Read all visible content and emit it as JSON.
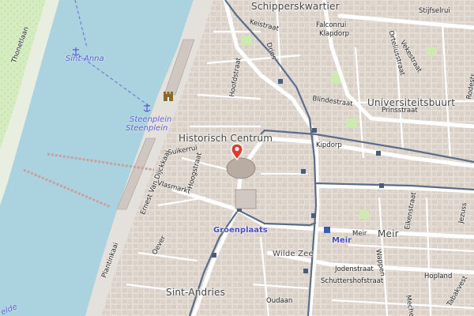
{
  "map": {
    "districts": {
      "schipperskwartier": "Schipperskwartier",
      "universiteitsbuurt": "Universiteitsbuurt",
      "historisch_centrum": "Historisch Centrum",
      "sint_andries": "Sint-Andries",
      "meir": "Meir"
    },
    "landmarks": {
      "sint_anna": "Sint-Anna",
      "steenplein_1": "Steenplein",
      "steenplein_2": "Steenplein",
      "groenplaats": "Groenplaats",
      "meir_station": "Meir",
      "wilde_zee": "Wilde Zee",
      "schelde": "elde"
    },
    "streets": {
      "keistraat": "Keistraat",
      "klapdorp": "Klapdorp",
      "falconrui": "Falconrui",
      "stijfselrui": "Stijfselrui",
      "vekestraat": "Vekestraat",
      "blindestraat": "Blindestraat",
      "prinsstraat": "Prinsstraat",
      "kipdorp": "Kipdorp",
      "suikerrui": "Suikerrui",
      "vlasmarkt": "Vlasmarkt",
      "hoogstraat": "Hoogstraat",
      "ernest_van_dijckkaai": "Ernest Van Dijckkaai",
      "plantinkaai": "Plantinkaai",
      "oever": "Oever",
      "wappen": "Wappen",
      "eikenstraat": "Eikenstraat",
      "meir_street": "Meir",
      "jodenstraat": "Jodenstraat",
      "schuttershofstraat": "Schuttershofstraat",
      "hopland": "Hopland",
      "oudaan": "Oudaan",
      "mechelse": "Mechel",
      "tabakvest": "Tabakvest",
      "jezusstraat": "Jezuss",
      "rodestraat": "Rodestr",
      "thonetlaan": "Thonetlaan",
      "hoofdkerk": "Hoofdstraat",
      "dries": "Dries",
      "korte": "Orteliusstraat"
    },
    "colors": {
      "water": "#aad3df",
      "land": "#f2efe9",
      "park": "#cdebb0",
      "building": "#d9d0c9",
      "tram": "#5a6d8a",
      "marker": "#e03c2e",
      "road": "#ffffff"
    },
    "marker_icon": "map-pin-icon",
    "castle_icon": "castle-icon",
    "anchor_icon": "anchor-icon"
  }
}
